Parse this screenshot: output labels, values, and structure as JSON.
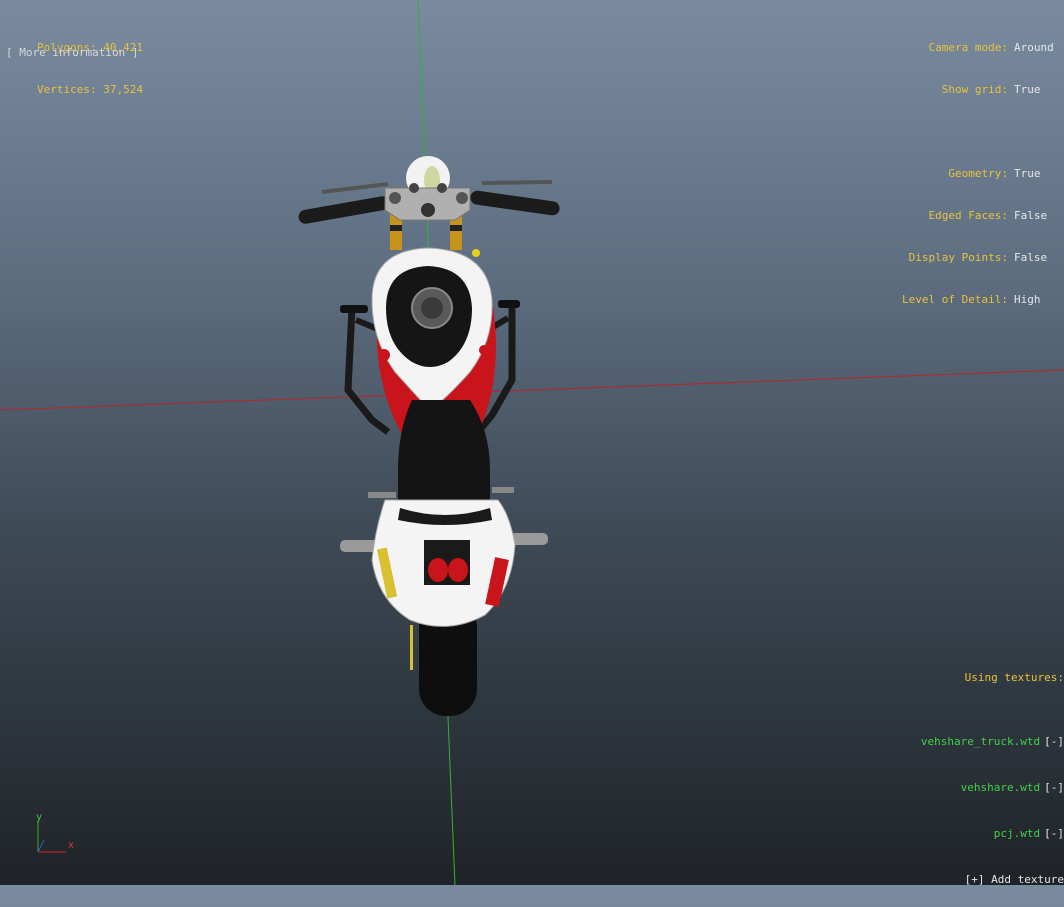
{
  "stats": {
    "polygons_label": "Polygons:",
    "polygons_value": "40,421",
    "vertices_label": "Vertices:",
    "vertices_value": "37,524"
  },
  "more_info_label": "[ More information ]",
  "settings": {
    "camera_mode_label": "Camera mode:",
    "camera_mode_value": "Around",
    "show_grid_label": "Show grid:",
    "show_grid_value": "True",
    "geometry_label": "Geometry:",
    "geometry_value": "True",
    "edged_faces_label": "Edged Faces:",
    "edged_faces_value": "False",
    "display_points_label": "Display Points:",
    "display_points_value": "False",
    "lod_label": "Level of Detail:",
    "lod_value": "High"
  },
  "textures": {
    "heading": "Using textures:",
    "items": [
      {
        "name": "vehshare_truck.wtd",
        "remove": "[-]"
      },
      {
        "name": "vehshare.wtd",
        "remove": "[-]"
      },
      {
        "name": "pcj.wtd",
        "remove": "[-]"
      }
    ],
    "add_label": "[+] Add texture"
  },
  "gizmo": {
    "y_label": "y",
    "x_label": "x"
  },
  "colors": {
    "label_yellow": "#e8c23a",
    "texture_green": "#3fd24a",
    "axis_red": "#c0262a",
    "axis_green": "#2fae2f",
    "bike_red": "#c8141a"
  }
}
